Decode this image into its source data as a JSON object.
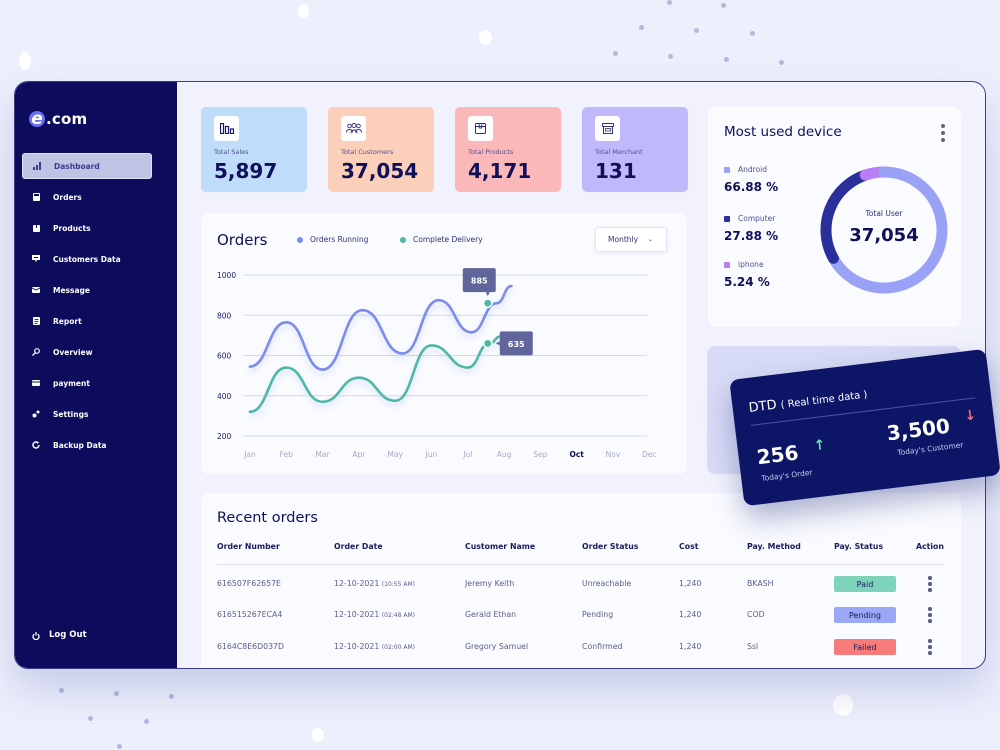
{
  "brand": {
    "logo_letter": "e",
    "logo_text": ".com"
  },
  "sidebar": {
    "items": [
      {
        "label": "Dashboard",
        "icon": "bar-chart-icon",
        "active": true
      },
      {
        "label": "Orders",
        "icon": "calculator-icon",
        "active": false
      },
      {
        "label": "Products",
        "icon": "box-icon",
        "active": false
      },
      {
        "label": "Customers Data",
        "icon": "chat-icon",
        "active": false
      },
      {
        "label": "Message",
        "icon": "mail-icon",
        "active": false
      },
      {
        "label": "Report",
        "icon": "document-icon",
        "active": false
      },
      {
        "label": "Overview",
        "icon": "search-icon",
        "active": false
      },
      {
        "label": "payment",
        "icon": "card-icon",
        "active": false
      },
      {
        "label": "Settings",
        "icon": "gear-icon",
        "active": false
      },
      {
        "label": "Backup Data",
        "icon": "refresh-icon",
        "active": false
      }
    ],
    "logout_label": "Log Out"
  },
  "stats": [
    {
      "label": "Total Sales",
      "value": "5,897",
      "icon": "bar-chart-icon",
      "color": "#bfdcfb"
    },
    {
      "label": "Total Customers",
      "value": "37,054",
      "icon": "users-icon",
      "color": "#fbcfba"
    },
    {
      "label": "Total Products",
      "value": "4,171",
      "icon": "box-icon",
      "color": "#fbb8bb"
    },
    {
      "label": "Total Merchant",
      "value": "131",
      "icon": "store-icon",
      "color": "#bfb9fb"
    }
  ],
  "orders_chart": {
    "title": "Orders",
    "dropdown_value": "Monthly",
    "highlight_month": "Oct"
  },
  "device": {
    "title": "Most used device",
    "center_label": "Total User",
    "center_value": "37,054",
    "items": [
      {
        "name": "Android",
        "pct": "66.88 %",
        "value": 66.88,
        "color": "#9aa2f7"
      },
      {
        "name": "Computer",
        "pct": "27.88 %",
        "value": 27.88,
        "color": "#2b2f9c"
      },
      {
        "name": "iphone",
        "pct": "5.24 %",
        "value": 5.24,
        "color": "#b87ef5"
      }
    ]
  },
  "dtd": {
    "title": "DTD",
    "subtitle": "( Real time data )",
    "orders_value": "256",
    "orders_label": "Today's Order",
    "orders_trend": "up",
    "customers_value": "3,500",
    "customers_label": "Today's Customer",
    "customers_trend": "down"
  },
  "recent_orders": {
    "title": "Recent orders",
    "columns": [
      "Order Number",
      "Order Date",
      "Customer Name",
      "Order Status",
      "Cost",
      "Pay. Method",
      "Pay. Status",
      "Action"
    ],
    "rows": [
      {
        "order_number": "616507F62657E",
        "date": "12-10-2021",
        "time": "(10:55 AM)",
        "customer": "Jeremy Keith",
        "status": "Unreachable",
        "cost": "1,240",
        "method": "BKASH",
        "pay_status": "Paid",
        "pay_color": "#7ed3bb"
      },
      {
        "order_number": "616515267ECA4",
        "date": "12-10-2021",
        "time": "(02:48 AM)",
        "customer": "Gerald Ethan",
        "status": "Pending",
        "cost": "1,240",
        "method": "COD",
        "pay_status": "Pending",
        "pay_color": "#9aa8f5"
      },
      {
        "order_number": "6164C8E6D037D",
        "date": "12-10-2021",
        "time": "(02:00 AM)",
        "customer": "Gregory Samuel",
        "status": "Confirmed",
        "cost": "1,240",
        "method": "Ssl",
        "pay_status": "Failed",
        "pay_color": "#f77b7b"
      }
    ]
  },
  "chart_data": {
    "type": "line",
    "title": "Orders",
    "xlabel": "",
    "ylabel": "",
    "categories": [
      "Jan",
      "Feb",
      "Mar",
      "Apr",
      "May",
      "Jun",
      "Jul",
      "Aug",
      "Sep",
      "Oct",
      "Nov",
      "Dec"
    ],
    "yticks": [
      200,
      400,
      600,
      800,
      1000
    ],
    "ylim": [
      200,
      1000
    ],
    "grid": true,
    "legend": "top",
    "series": [
      {
        "name": "Orders Running",
        "color": "#7c8cec",
        "x": [
          0,
          1,
          2.1,
          3.2,
          4.2,
          5.3,
          6.4,
          7.3,
          8.0,
          8.6,
          9.2
        ],
        "values": [
          545,
          765,
          530,
          825,
          610,
          875,
          715,
          885,
          945
        ],
        "points": [
          [
            0,
            545
          ],
          [
            1,
            765
          ],
          [
            2,
            530
          ],
          [
            3.1,
            825
          ],
          [
            4.2,
            610
          ],
          [
            5.2,
            875
          ],
          [
            6.1,
            715
          ],
          [
            6.8,
            860
          ],
          [
            7.2,
            945
          ]
        ]
      },
      {
        "name": "Complete Delivery",
        "color": "#4fb7a4",
        "values": [
          320,
          540,
          370,
          490,
          375,
          650,
          540,
          660,
          695
        ],
        "points": [
          [
            0,
            320
          ],
          [
            1,
            540
          ],
          [
            2,
            370
          ],
          [
            3,
            490
          ],
          [
            4,
            375
          ],
          [
            5,
            650
          ],
          [
            6,
            540
          ],
          [
            6.6,
            660
          ],
          [
            6.9,
            695
          ]
        ]
      }
    ],
    "annotations": [
      {
        "series": "Orders Running",
        "month": "Oct",
        "value": 885,
        "label": "885"
      },
      {
        "series": "Complete Delivery",
        "month": "Oct",
        "value": 635,
        "label": "635"
      }
    ]
  }
}
